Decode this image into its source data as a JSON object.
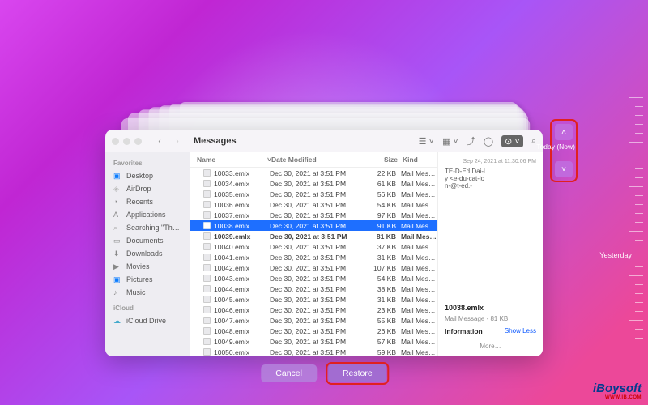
{
  "window": {
    "title": "Messages"
  },
  "sidebar": {
    "heading1": "Favorites",
    "heading2": "iCloud",
    "items": [
      {
        "label": "Desktop",
        "color": "#0a7cff"
      },
      {
        "label": "AirDrop",
        "color": "#bbb"
      },
      {
        "label": "Recents",
        "color": "#888"
      },
      {
        "label": "Applications",
        "color": "#888"
      },
      {
        "label": "Searching \"Th…",
        "color": "#aaa"
      },
      {
        "label": "Documents",
        "color": "#888"
      },
      {
        "label": "Downloads",
        "color": "#888"
      },
      {
        "label": "Movies",
        "color": "#888"
      },
      {
        "label": "Pictures",
        "color": "#0a7cff"
      },
      {
        "label": "Music",
        "color": "#888"
      }
    ],
    "icloud_item": "iCloud Drive"
  },
  "columns": {
    "name": "Name",
    "date": "Date Modified",
    "size": "Size",
    "kind": "Kind"
  },
  "files": [
    {
      "name": "10033.emlx",
      "date": "Dec 30, 2021 at 3:51 PM",
      "size": "22 KB",
      "kind": "Mail Mes…"
    },
    {
      "name": "10034.emlx",
      "date": "Dec 30, 2021 at 3:51 PM",
      "size": "61 KB",
      "kind": "Mail Mes…"
    },
    {
      "name": "10035.emlx",
      "date": "Dec 30, 2021 at 3:51 PM",
      "size": "56 KB",
      "kind": "Mail Mes…"
    },
    {
      "name": "10036.emlx",
      "date": "Dec 30, 2021 at 3:51 PM",
      "size": "54 KB",
      "kind": "Mail Mes…"
    },
    {
      "name": "10037.emlx",
      "date": "Dec 30, 2021 at 3:51 PM",
      "size": "97 KB",
      "kind": "Mail Mes…"
    },
    {
      "name": "10038.emlx",
      "date": "Dec 30, 2021 at 3:51 PM",
      "size": "91 KB",
      "kind": "Mail Mes…",
      "selected": true
    },
    {
      "name": "10039.emlx",
      "date": "Dec 30, 2021 at 3:51 PM",
      "size": "81 KB",
      "kind": "Mail Mes…",
      "bold": true
    },
    {
      "name": "10040.emlx",
      "date": "Dec 30, 2021 at 3:51 PM",
      "size": "37 KB",
      "kind": "Mail Mes…"
    },
    {
      "name": "10041.emlx",
      "date": "Dec 30, 2021 at 3:51 PM",
      "size": "31 KB",
      "kind": "Mail Mes…"
    },
    {
      "name": "10042.emlx",
      "date": "Dec 30, 2021 at 3:51 PM",
      "size": "107 KB",
      "kind": "Mail Mes…"
    },
    {
      "name": "10043.emlx",
      "date": "Dec 30, 2021 at 3:51 PM",
      "size": "54 KB",
      "kind": "Mail Mes…"
    },
    {
      "name": "10044.emlx",
      "date": "Dec 30, 2021 at 3:51 PM",
      "size": "38 KB",
      "kind": "Mail Mes…"
    },
    {
      "name": "10045.emlx",
      "date": "Dec 30, 2021 at 3:51 PM",
      "size": "31 KB",
      "kind": "Mail Mes…"
    },
    {
      "name": "10046.emlx",
      "date": "Dec 30, 2021 at 3:51 PM",
      "size": "23 KB",
      "kind": "Mail Mes…"
    },
    {
      "name": "10047.emlx",
      "date": "Dec 30, 2021 at 3:51 PM",
      "size": "55 KB",
      "kind": "Mail Mes…"
    },
    {
      "name": "10048.emlx",
      "date": "Dec 30, 2021 at 3:51 PM",
      "size": "26 KB",
      "kind": "Mail Mes…"
    },
    {
      "name": "10049.emlx",
      "date": "Dec 30, 2021 at 3:51 PM",
      "size": "57 KB",
      "kind": "Mail Mes…"
    },
    {
      "name": "10050.emlx",
      "date": "Dec 30, 2021 at 3:51 PM",
      "size": "59 KB",
      "kind": "Mail Mes…"
    }
  ],
  "preview": {
    "subject": "TE-D-Ed Dai-ly <e-du-cat-ion-@t-ed.-",
    "header_date": "Sep 24, 2021 at 11:30:06 PM",
    "filename": "10038.emlx",
    "kind_size": "Mail Message - 81 KB",
    "info_head": "Information",
    "show_less": "Show Less",
    "more": "More…"
  },
  "buttons": {
    "cancel": "Cancel",
    "restore": "Restore"
  },
  "timeline": {
    "today": "Today (Now)",
    "yesterday": "Yesterday"
  },
  "watermark": {
    "brand": "iBoysoft",
    "sub": "WWW.IB.COM"
  }
}
